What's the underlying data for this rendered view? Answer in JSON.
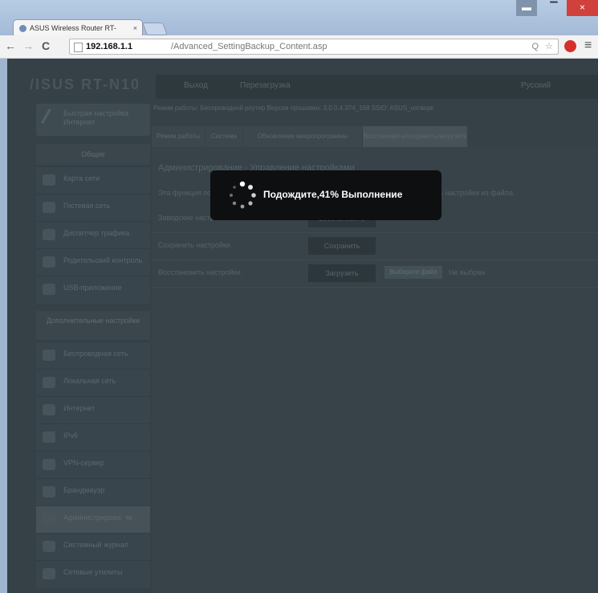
{
  "browser": {
    "tab_title": "ASUS Wireless Router RT-",
    "tab_close": "×",
    "url_host": "192.168.1.1",
    "url_path": "/Advanced_SettingBackup_Content.asp",
    "zoom_label": "Q",
    "menu_glyph": "≡",
    "back_glyph": "←",
    "forward_glyph": "→",
    "reload_glyph": "C"
  },
  "router": {
    "logo": "/ISUS RT-N10",
    "top_nav": [
      "Выход",
      "Перезагрузка"
    ],
    "language": "Русский",
    "quick_setup": "Быстрая настройка Интернет",
    "status_line": "Режим работы: Беспроводной роутер Версия прошивки: 3.0.0.4.374_168 SSID: ASUS_нэтворк",
    "sidebar_general": "Общие",
    "sidebar_items_general": [
      "Карта сети",
      "Гостевая сеть",
      "Диспетчер трафика",
      "Родительский контроль",
      "USB-приложение"
    ],
    "sidebar_advanced": "Дополнительные настройки",
    "sidebar_items_advanced": [
      "Беспроводная сеть",
      "Локальная сеть",
      "Интернет",
      "IPv6",
      "VPN-сервер",
      "Брандмауэр",
      "Администрирование",
      "Системный журнал",
      "Сетевые утилиты"
    ],
    "sub_tabs": [
      "Режим работы",
      "Система",
      "Обновление микропрограммы",
      "Восстановить/сохранить/загрузить настройки"
    ],
    "panel_title": "Администрирование - Управление настройками",
    "panel_desc": "Эта функция позволяет сохранить текущие настройки роутера в файл или загрузить настройки из файла.",
    "rows": [
      {
        "label": "Заводские настройки",
        "button": "Восстановить"
      },
      {
        "label": "Сохранить настройки",
        "button": "Сохранить"
      },
      {
        "label": "Восстановить настройки",
        "button": "Загрузить"
      }
    ],
    "file_button": "Выберите файл",
    "file_status": "Не выбран"
  },
  "popup": {
    "message": "Подождите,41% Выполнение",
    "progress_percent": 41
  }
}
